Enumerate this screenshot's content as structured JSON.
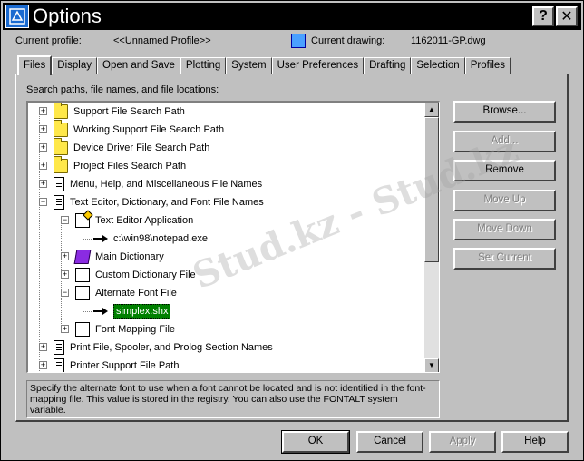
{
  "window": {
    "title": "Options",
    "help_glyph": "?",
    "close_glyph": "✕",
    "icon": "autocad-options-icon"
  },
  "profile": {
    "label": "Current profile:",
    "value": "<<Unnamed Profile>>",
    "drawing_label": "Current drawing:",
    "drawing_value": "1162011-GP.dwg"
  },
  "tabs": [
    {
      "label": "Files",
      "active": true
    },
    {
      "label": "Display"
    },
    {
      "label": "Open and Save"
    },
    {
      "label": "Plotting"
    },
    {
      "label": "System"
    },
    {
      "label": "User Preferences"
    },
    {
      "label": "Drafting"
    },
    {
      "label": "Selection"
    },
    {
      "label": "Profiles"
    }
  ],
  "files": {
    "section_label": "Search paths, file names, and file locations:",
    "tree": [
      {
        "label": "Support File Search Path",
        "icon": "folder-icon",
        "expander": "+"
      },
      {
        "label": "Working Support File Search Path",
        "icon": "folder-icon",
        "expander": "+"
      },
      {
        "label": "Device Driver File Search Path",
        "icon": "folder-icon",
        "expander": "+"
      },
      {
        "label": "Project Files Search Path",
        "icon": "project-icon",
        "expander": "+"
      },
      {
        "label": "Menu, Help, and Miscellaneous File Names",
        "icon": "document-icon",
        "expander": "+"
      },
      {
        "label": "Text Editor, Dictionary, and Font File Names",
        "icon": "documents-icon",
        "expander": "−"
      },
      {
        "label": "Text Editor Application",
        "icon": "notepad-icon",
        "expander": "−"
      },
      {
        "label": "c:\\win98\\notepad.exe",
        "icon": "arrow-icon"
      },
      {
        "label": "Main Dictionary",
        "icon": "book-icon",
        "expander": "+"
      },
      {
        "label": "Custom Dictionary File",
        "icon": "dictionary-file-icon",
        "expander": "+"
      },
      {
        "label": "Alternate Font File",
        "icon": "font-file-icon",
        "expander": "−"
      },
      {
        "label": "simplex.shx",
        "icon": "arrow-icon",
        "selected": true
      },
      {
        "label": "Font Mapping File",
        "icon": "font-mapping-icon",
        "expander": "+"
      },
      {
        "label": "Print File, Spooler, and Prolog Section Names",
        "icon": "document-icon",
        "expander": "+"
      },
      {
        "label": "Printer Support File Path",
        "icon": "document-icon",
        "expander": "+"
      }
    ],
    "description": "Specify the alternate font to use when a font cannot be located and is not identified in the font-mapping file. This value is stored in the registry. You can also use the FONTALT system variable.",
    "scroll_up": "▲",
    "scroll_down": "▼"
  },
  "side_buttons": {
    "browse": "Browse...",
    "add": "Add...",
    "remove": "Remove",
    "move_up": "Move Up",
    "move_down": "Move Down",
    "set_current": "Set Current"
  },
  "bottom_buttons": {
    "ok": "OK",
    "cancel": "Cancel",
    "apply": "Apply",
    "help": "Help"
  },
  "watermark": {
    "text": "Stud.kz - Stud.kz"
  }
}
